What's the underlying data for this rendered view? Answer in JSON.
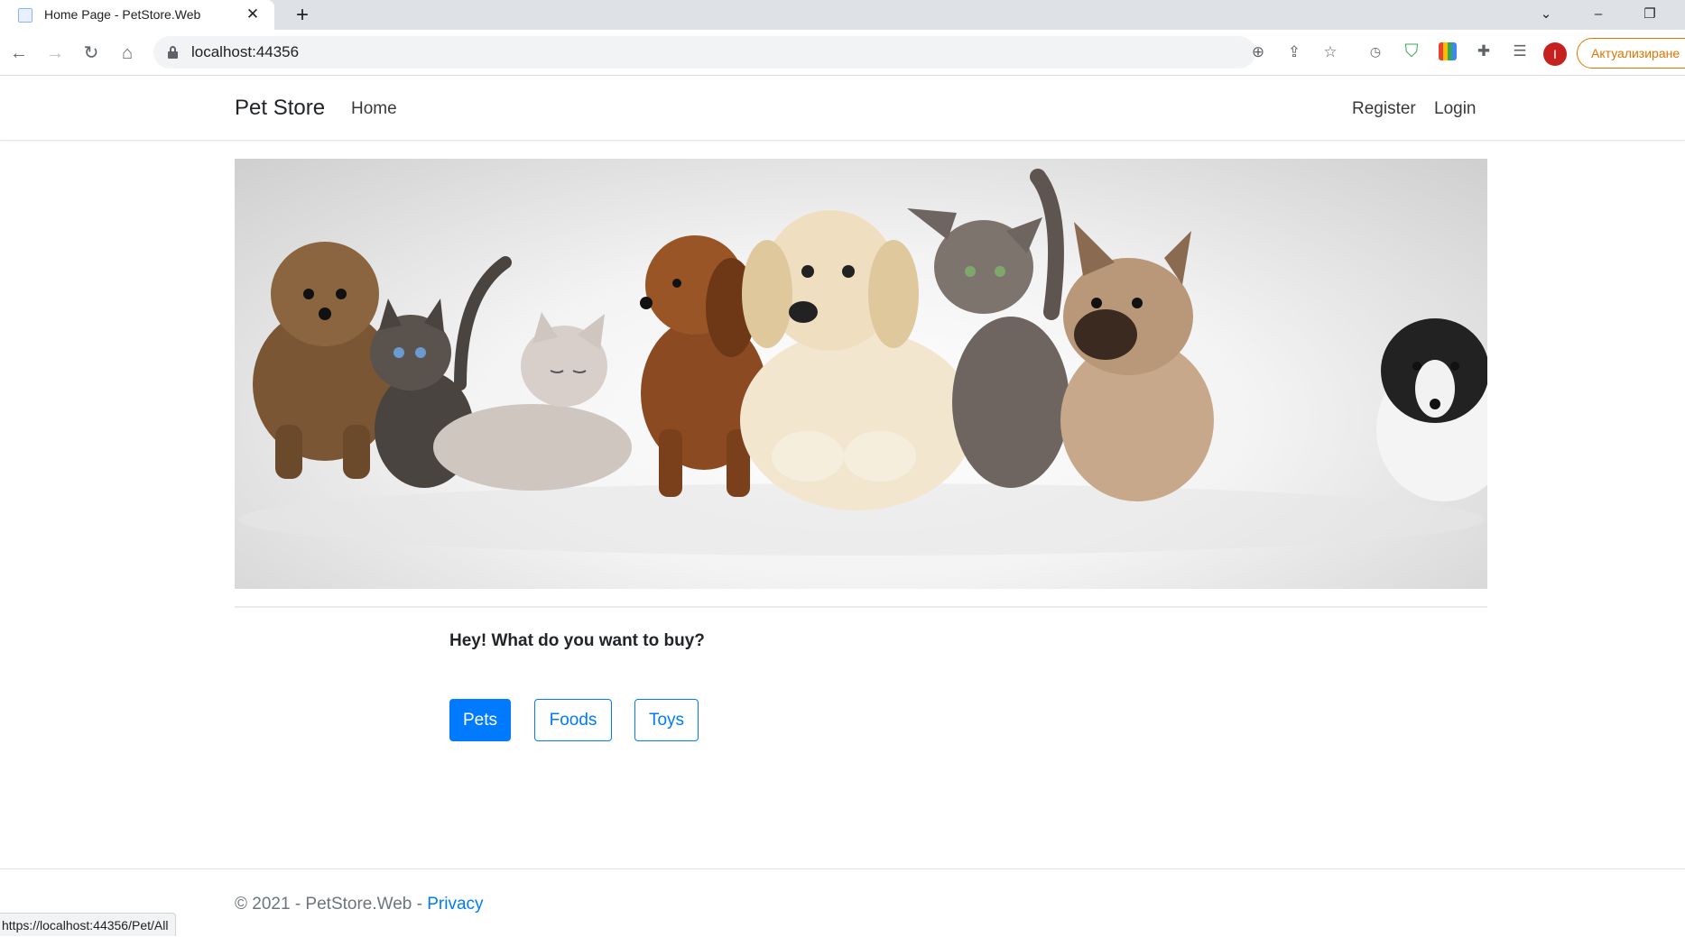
{
  "browser": {
    "tab_title": "Home Page - PetStore.Web",
    "url": "localhost:44356",
    "update_button": "Актуализиране",
    "profile_initial": "I",
    "status_url": "https://localhost:44356/Pet/All"
  },
  "site": {
    "brand": "Pet Store",
    "nav_home": "Home",
    "nav_register": "Register",
    "nav_login": "Login"
  },
  "main": {
    "question": "Hey! What do you want to buy?",
    "buttons": {
      "pets": "Pets",
      "foods": "Foods",
      "toys": "Toys"
    }
  },
  "footer": {
    "copyright": "© 2021 - PetStore.Web - ",
    "privacy": "Privacy"
  },
  "colors": {
    "primary": "#007bff",
    "update_accent": "#e37400",
    "profile": "#c5221f"
  }
}
